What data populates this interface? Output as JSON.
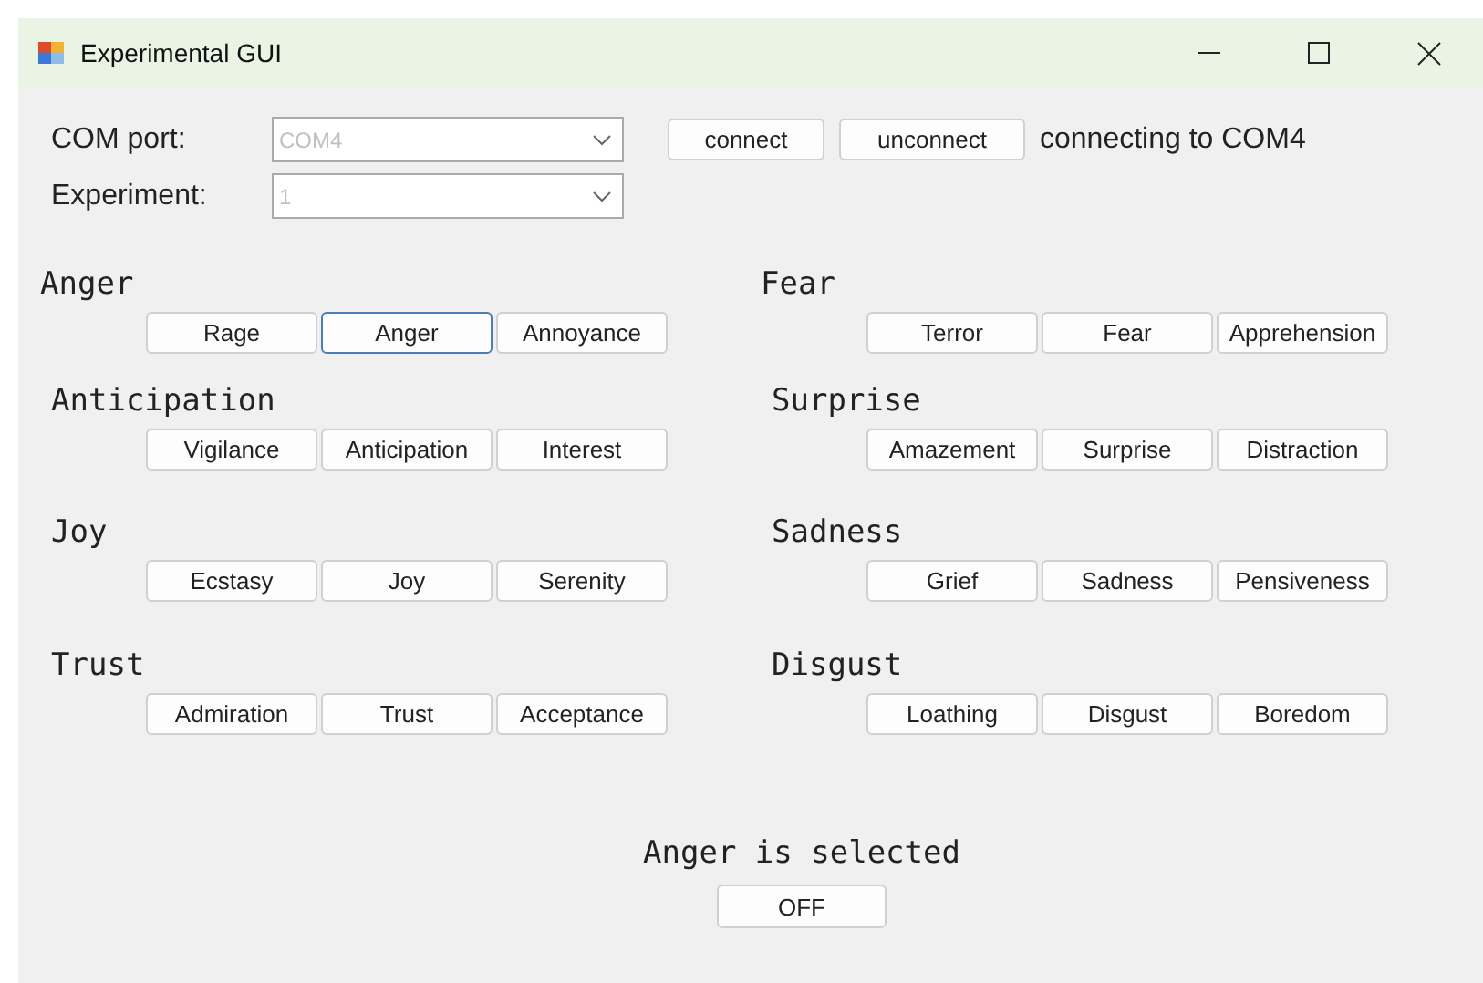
{
  "window": {
    "title": "Experimental GUI"
  },
  "com_port": {
    "label": "COM port:",
    "value": "COM4",
    "disabled": true
  },
  "experiment": {
    "label": "Experiment:",
    "value": "1",
    "disabled": true
  },
  "connection_buttons": [
    "connect",
    "unconnect"
  ],
  "connection_status": "connecting to COM4",
  "groups": [
    {
      "title": "Anger",
      "buttons": [
        {
          "label": "Rage",
          "selected": false
        },
        {
          "label": "Anger",
          "selected": true
        },
        {
          "label": "Annoyance",
          "selected": false
        }
      ]
    },
    {
      "title": "Fear",
      "buttons": [
        {
          "label": "Terror",
          "selected": false
        },
        {
          "label": "Fear",
          "selected": false
        },
        {
          "label": "Apprehension",
          "selected": false
        }
      ]
    },
    {
      "title": "Anticipation",
      "buttons": [
        {
          "label": "Vigilance",
          "selected": false
        },
        {
          "label": "Anticipation",
          "selected": false
        },
        {
          "label": "Interest",
          "selected": false
        }
      ]
    },
    {
      "title": "Surprise",
      "buttons": [
        {
          "label": "Amazement",
          "selected": false
        },
        {
          "label": "Surprise",
          "selected": false
        },
        {
          "label": "Distraction",
          "selected": false
        }
      ]
    },
    {
      "title": "Joy",
      "buttons": [
        {
          "label": "Ecstasy",
          "selected": false
        },
        {
          "label": "Joy",
          "selected": false
        },
        {
          "label": "Serenity",
          "selected": false
        }
      ]
    },
    {
      "title": "Sadness",
      "buttons": [
        {
          "label": "Grief",
          "selected": false
        },
        {
          "label": "Sadness",
          "selected": false
        },
        {
          "label": "Pensiveness",
          "selected": false
        }
      ]
    },
    {
      "title": "Trust",
      "buttons": [
        {
          "label": "Admiration",
          "selected": false
        },
        {
          "label": "Trust",
          "selected": false
        },
        {
          "label": "Acceptance",
          "selected": false
        }
      ]
    },
    {
      "title": "Disgust",
      "buttons": [
        {
          "label": "Loathing",
          "selected": false
        },
        {
          "label": "Disgust",
          "selected": false
        },
        {
          "label": "Boredom",
          "selected": false
        }
      ]
    }
  ],
  "selection_status": "Anger is selected",
  "toggle_button": "OFF"
}
